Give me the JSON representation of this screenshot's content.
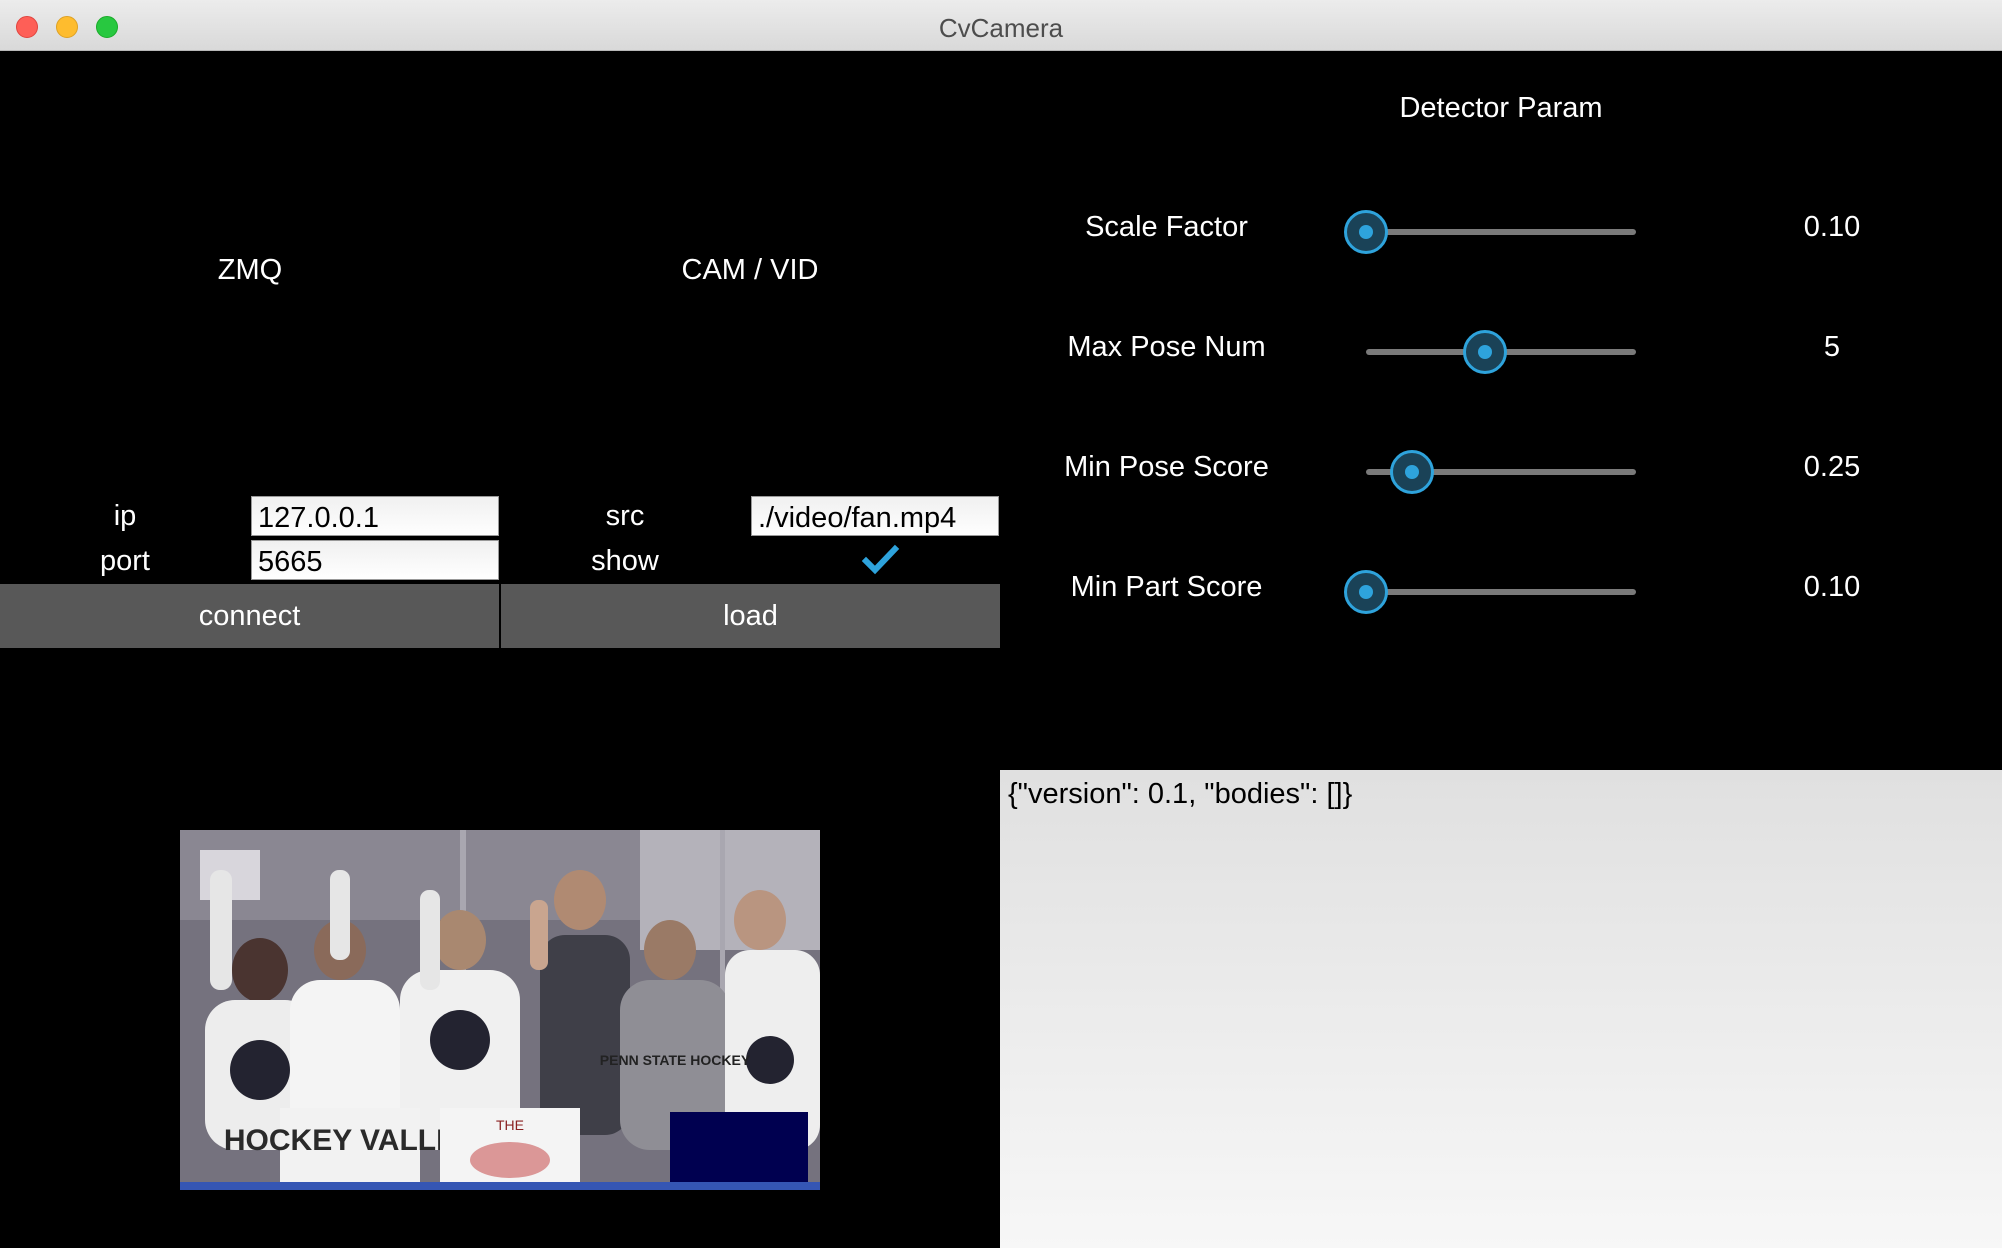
{
  "window": {
    "title": "CvCamera"
  },
  "zmq": {
    "header": "ZMQ",
    "ip_label": "ip",
    "ip_value": "127.0.0.1",
    "port_label": "port",
    "port_value": "5665",
    "connect_label": "connect"
  },
  "cam": {
    "header": "CAM / VID",
    "src_label": "src",
    "src_value": "./video/fan.mp4",
    "show_label": "show",
    "show_checked": true,
    "load_label": "load"
  },
  "detector": {
    "header": "Detector Param",
    "params": [
      {
        "label": "Scale Factor",
        "value": "0.10",
        "fraction": 0.0
      },
      {
        "label": "Max Pose Num",
        "value": "5",
        "fraction": 0.44
      },
      {
        "label": "Min Pose Score",
        "value": "0.25",
        "fraction": 0.17
      },
      {
        "label": "Min Part Score",
        "value": "0.10",
        "fraction": 0.0
      }
    ]
  },
  "output": {
    "text": "{\"version\": 0.1, \"bodies\": []}"
  },
  "video": {
    "sign_text": "HOCKEY VALLEY",
    "shirt_text": "PENN STATE HOCKEY",
    "board_text": "THE"
  },
  "colors": {
    "accent": "#2ea3dc",
    "button": "#585858",
    "background": "#000000"
  }
}
